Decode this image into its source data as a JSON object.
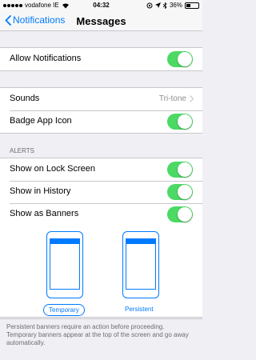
{
  "status_bar": {
    "carrier": "vodafone IE",
    "time": "04:32",
    "battery_percent": "36%",
    "battery_level": 0.36
  },
  "nav": {
    "back_label": "Notifications",
    "title": "Messages"
  },
  "allow_notifications": {
    "label": "Allow Notifications",
    "enabled": true
  },
  "sounds": {
    "label": "Sounds",
    "value": "Tri-tone"
  },
  "badge": {
    "label": "Badge App Icon",
    "enabled": true
  },
  "alerts": {
    "header": "ALERTS",
    "items": [
      {
        "label": "Show on Lock Screen",
        "enabled": true
      },
      {
        "label": "Show in History",
        "enabled": true
      },
      {
        "label": "Show as Banners",
        "enabled": true
      }
    ],
    "styles": [
      {
        "label": "Temporary",
        "selected": true
      },
      {
        "label": "Persistent",
        "selected": false
      }
    ]
  },
  "footer": "Persistent banners require an action before proceeding. Temporary banners appear at the top of the screen and go away automatically.",
  "colors": {
    "accent": "#007aff",
    "toggle_on": "#4cd964",
    "background": "#efeff4"
  }
}
